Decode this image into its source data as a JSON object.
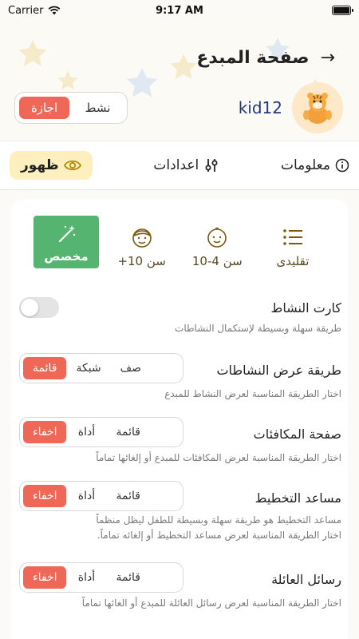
{
  "status_bar": {
    "carrier": "Carrier",
    "time": "9:17 AM"
  },
  "header": {
    "title": "صفحة المبدع"
  },
  "profile": {
    "name": "kid12"
  },
  "status_toggle": {
    "options": [
      "اجازة",
      "نشط"
    ],
    "selected": "اجازة"
  },
  "tabs": [
    {
      "label": "ظهور",
      "icon": "eye-icon",
      "active": true
    },
    {
      "label": "اعدادات",
      "icon": "sliders-icon",
      "active": false
    },
    {
      "label": "معلومات",
      "icon": "info-icon",
      "active": false
    }
  ],
  "age_modes": [
    {
      "label": "مخصص",
      "icon": "magic-wand-icon",
      "active": true
    },
    {
      "label": "سن 10+",
      "icon": "boy-face-icon",
      "active": false
    },
    {
      "label": "سن 4-10",
      "icon": "baby-face-icon",
      "active": false
    },
    {
      "label": "تقليدى",
      "icon": "list-icon",
      "active": false
    }
  ],
  "settings": {
    "activity_card": {
      "title": "كارت النشاط",
      "desc": "طريقة سهلة وبسيطة لإستكمال النشاطات",
      "enabled": false
    },
    "display_mode": {
      "title": "طريقة عرض النشاطات",
      "desc": "اختار الطريقة المناسبة لعرض النشاط للمبدع",
      "options": [
        "قائمة",
        "شبكة",
        "صف"
      ],
      "selected": "قائمة"
    },
    "rewards_page": {
      "title": "صفحة المكافئات",
      "desc": "اختار الطريقة المناسبة لعرض المكافئات للمبدع أو إلغائها تماماً",
      "options": [
        "اخفاء",
        "أداة",
        "قائمة"
      ],
      "selected": "اخفاء"
    },
    "planner": {
      "title": "مساعد التخطيط",
      "desc_line1": "مساعد التخطيط هو طريقة سهلة وبسيطة للطفل ليظل منظماً",
      "desc_line2": "اختار الطريقة المناسبة لعرض مساعد التخطيط أو إلغائه تماماً.",
      "options": [
        "اخفاء",
        "أداة",
        "قائمة"
      ],
      "selected": "اخفاء"
    },
    "family_messages": {
      "title": "رسائل العائلة",
      "desc": "اختار الطريقة المناسبة لعرض رسائل العائلة للمبدع أو الغائها تماماً",
      "options": [
        "اخفاء",
        "أداة",
        "قائمة"
      ],
      "selected": "اخفاء"
    }
  },
  "colors": {
    "accent_red": "#ee6757",
    "accent_green": "#55b46f",
    "tab_active_bg": "#fdf0be",
    "profile_name": "#233a7a"
  }
}
